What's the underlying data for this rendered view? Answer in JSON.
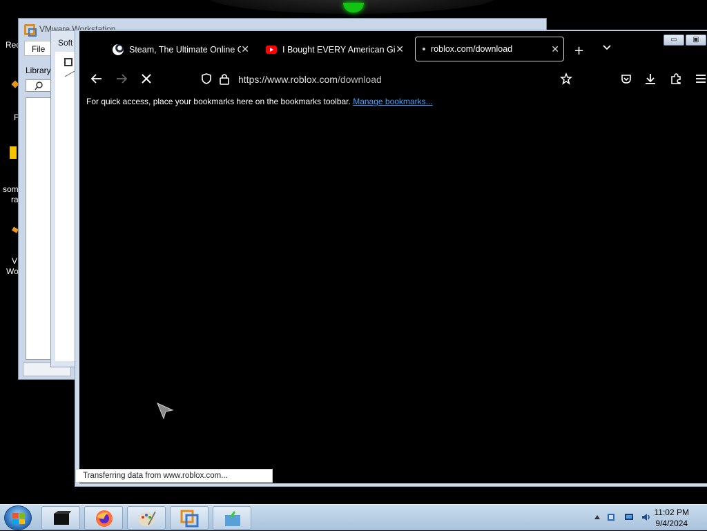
{
  "desktop": {
    "icon_labels": [
      "Rec",
      "F",
      "som",
      "ra",
      "V",
      "Wo"
    ]
  },
  "vmware": {
    "title": "VMware Workstation",
    "menu_file": "File",
    "library_label": "Library"
  },
  "software_panel": {
    "title": "Soft"
  },
  "firefox": {
    "tabs": [
      {
        "title": "Steam, The Ultimate Online Ga",
        "icon": "steam-icon"
      },
      {
        "title": "I Bought EVERY American Girl D",
        "icon": "youtube-icon"
      },
      {
        "title": "roblox.com/download",
        "icon": "loading-dot-icon"
      }
    ],
    "url": "https://www.roblox.com/download",
    "url_host": "https://www.roblox.com",
    "url_path": "/download",
    "bookmarks_hint": "For quick access, place your bookmarks here on the bookmarks toolbar.",
    "manage_bookmarks": "Manage bookmarks...",
    "status": "Transferring data from www.roblox.com...",
    "window_buttons": {
      "minimize": "▭",
      "maximize": "▣",
      "close": "✕"
    }
  },
  "taskbar": {
    "apps": [
      "terminal-icon",
      "firefox-icon",
      "paint-icon",
      "vmware-icon",
      "installer-icon"
    ],
    "time": "11:02 PM",
    "date": "9/4/2024"
  },
  "colors": {
    "link": "#45a1ff",
    "taskbar": "#b7cde3",
    "accent_green": "#13c313"
  }
}
